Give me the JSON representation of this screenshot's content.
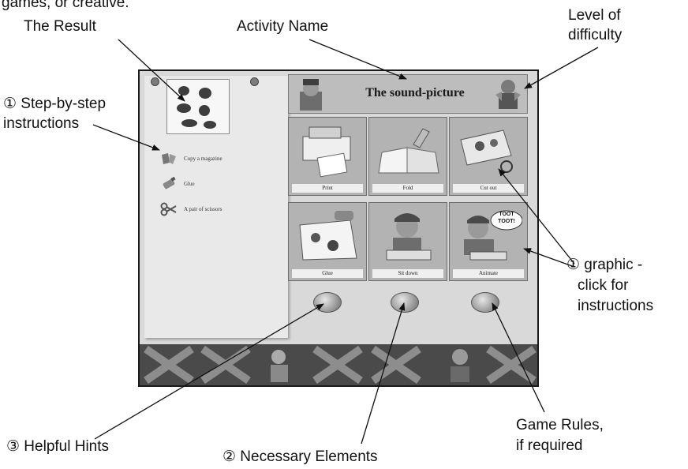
{
  "callouts": {
    "top_text": "games, or creative.",
    "result": "The Result",
    "activity_name": "Activity Name",
    "level_line1": "Level of",
    "level_line2": "difficulty",
    "step_line1": "① Step-by-step",
    "step_line2": "instructions",
    "graphic_line1": "① graphic -",
    "graphic_line2": "click for",
    "graphic_line3": "instructions",
    "hints": "③ Helpful Hints",
    "elements": "② Necessary Elements",
    "rules_line1": "Game Rules,",
    "rules_line2": "if required"
  },
  "app": {
    "activity_title": "The sound-picture",
    "steps": [
      {
        "label": "Copy a magazine",
        "icon": "magazine-icon"
      },
      {
        "label": "Glue",
        "icon": "glue-icon"
      },
      {
        "label": "A pair of scissors",
        "icon": "scissors-icon"
      }
    ],
    "tiles": [
      {
        "label": "Print",
        "icon": "printer-icon"
      },
      {
        "label": "Fold",
        "icon": "folded-paper-icon"
      },
      {
        "label": "Cut out",
        "icon": "cut-out-icon"
      },
      {
        "label": "Glue",
        "icon": "glue-sheet-icon"
      },
      {
        "label": "Sit down",
        "icon": "child-drawing-icon"
      },
      {
        "label": "Animate",
        "icon": "child-speaking-icon"
      }
    ],
    "speech_bubble": "TOOT TOOT!",
    "buttons": [
      {
        "name": "helpful-hints-button"
      },
      {
        "name": "necessary-elements-button"
      },
      {
        "name": "game-rules-button"
      }
    ],
    "colors": {
      "background": "#d9d9d9",
      "tile": "#b3b3b3",
      "bottom_bar": "#4a4a4a"
    }
  }
}
